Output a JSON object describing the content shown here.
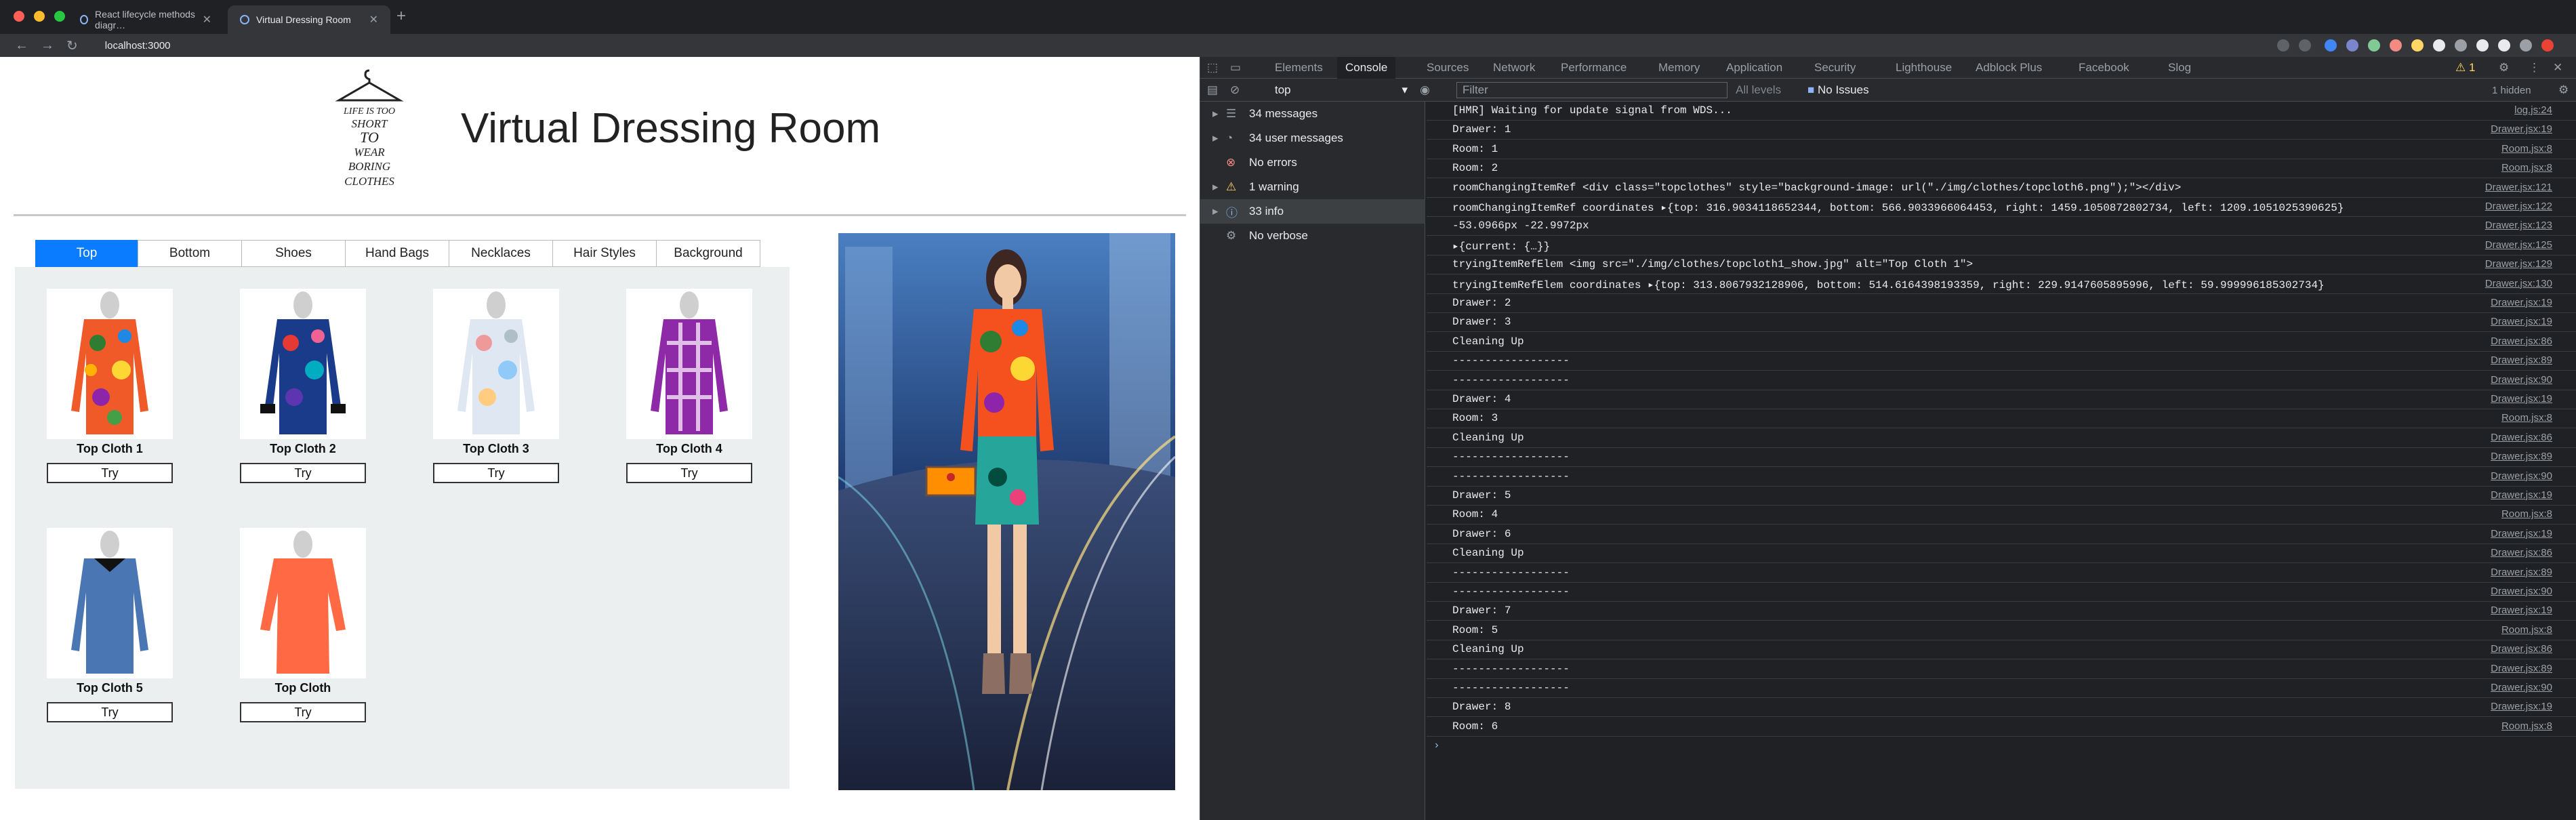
{
  "browser": {
    "tabs": [
      {
        "title": "React lifecycle methods diagr…",
        "active": false
      },
      {
        "title": "Virtual Dressing Room",
        "active": true
      }
    ],
    "url": "localhost:3000"
  },
  "app": {
    "logo_text": [
      "LIFE IS TOO",
      "SHORT",
      "TO",
      "WEAR",
      "BORING",
      "CLOTHES"
    ],
    "title": "Virtual Dressing Room",
    "tabs": [
      "Top",
      "Bottom",
      "Shoes",
      "Hand Bags",
      "Necklaces",
      "Hair Styles",
      "Background"
    ],
    "active_tab": "Top",
    "items": [
      {
        "label": "Top Cloth 1",
        "button": "Try"
      },
      {
        "label": "Top Cloth 2",
        "button": "Try"
      },
      {
        "label": "Top Cloth 3",
        "button": "Try"
      },
      {
        "label": "Top Cloth 4",
        "button": "Try"
      },
      {
        "label": "Top Cloth 5",
        "button": "Try"
      },
      {
        "label": "Top Cloth",
        "button": "Try"
      }
    ]
  },
  "devtools": {
    "tabs": [
      "Elements",
      "Console",
      "Sources",
      "Network",
      "Performance",
      "Memory",
      "Application",
      "Security",
      "Lighthouse",
      "Adblock Plus",
      "Facebook",
      "Slog"
    ],
    "active_tab": "Console",
    "warning_count": "1",
    "context": "top",
    "filter_placeholder": "Filter",
    "levels": "All levels",
    "issues": "No Issues",
    "hidden": "1 hidden",
    "sidebar": [
      {
        "label": "34 messages",
        "icon": "list-icon"
      },
      {
        "label": "34 user messages",
        "icon": "user-icon"
      },
      {
        "label": "No errors",
        "icon": "error-icon"
      },
      {
        "label": "1 warning",
        "icon": "warning-icon"
      },
      {
        "label": "33 info",
        "icon": "info-icon"
      },
      {
        "label": "No verbose",
        "icon": "gear-icon"
      }
    ],
    "logs": [
      {
        "text": "[HMR] Waiting for update signal from WDS...",
        "src": "log.js:24"
      },
      {
        "text": "Drawer: 1",
        "src": "Drawer.jsx:19"
      },
      {
        "text": "Room: 1",
        "src": "Room.jsx:8"
      },
      {
        "text": "Room: 2",
        "src": "Room.jsx:8"
      },
      {
        "text": "roomChangingItemRef  <div class=\"topclothes\" style=\"background-image: url(\"./img/clothes/topcloth6.png\");\"></div>",
        "src": "Drawer.jsx:121"
      },
      {
        "text": "roomChangingItemRef coordinates ▸{top: 316.9034118652344, bottom: 566.9033966064453, right: 1459.1050872802734, left: 1209.1051025390625}",
        "src": "Drawer.jsx:122"
      },
      {
        "text": "-53.0966px -22.9972px",
        "src": "Drawer.jsx:123"
      },
      {
        "text": "▸{current: {…}}",
        "src": "Drawer.jsx:125"
      },
      {
        "text": "tryingItemRefElem  <img src=\"./img/clothes/topcloth1_show.jpg\" alt=\"Top Cloth 1\">",
        "src": "Drawer.jsx:129"
      },
      {
        "text": "tryingItemRefElem coordinates ▸{top: 313.8067932128906, bottom: 514.6164398193359, right: 229.9147605895996, left: 59.999996185302734}",
        "src": "Drawer.jsx:130"
      },
      {
        "text": "Drawer: 2",
        "src": "Drawer.jsx:19"
      },
      {
        "text": "Drawer: 3",
        "src": "Drawer.jsx:19"
      },
      {
        "text": "Cleaning Up",
        "src": "Drawer.jsx:86"
      },
      {
        "text": "------------------",
        "src": "Drawer.jsx:89"
      },
      {
        "text": "------------------",
        "src": "Drawer.jsx:90"
      },
      {
        "text": "Drawer: 4",
        "src": "Drawer.jsx:19"
      },
      {
        "text": "Room: 3",
        "src": "Room.jsx:8"
      },
      {
        "text": "Cleaning Up",
        "src": "Drawer.jsx:86"
      },
      {
        "text": "------------------",
        "src": "Drawer.jsx:89"
      },
      {
        "text": "------------------",
        "src": "Drawer.jsx:90"
      },
      {
        "text": "Drawer: 5",
        "src": "Drawer.jsx:19"
      },
      {
        "text": "Room: 4",
        "src": "Room.jsx:8"
      },
      {
        "text": "Drawer: 6",
        "src": "Drawer.jsx:19"
      },
      {
        "text": "Cleaning Up",
        "src": "Drawer.jsx:86"
      },
      {
        "text": "------------------",
        "src": "Drawer.jsx:89"
      },
      {
        "text": "------------------",
        "src": "Drawer.jsx:90"
      },
      {
        "text": "Drawer: 7",
        "src": "Drawer.jsx:19"
      },
      {
        "text": "Room: 5",
        "src": "Room.jsx:8"
      },
      {
        "text": "Cleaning Up",
        "src": "Drawer.jsx:86"
      },
      {
        "text": "------------------",
        "src": "Drawer.jsx:89"
      },
      {
        "text": "------------------",
        "src": "Drawer.jsx:90"
      },
      {
        "text": "Drawer: 8",
        "src": "Drawer.jsx:19"
      },
      {
        "text": "Room: 6",
        "src": "Room.jsx:8"
      }
    ]
  }
}
